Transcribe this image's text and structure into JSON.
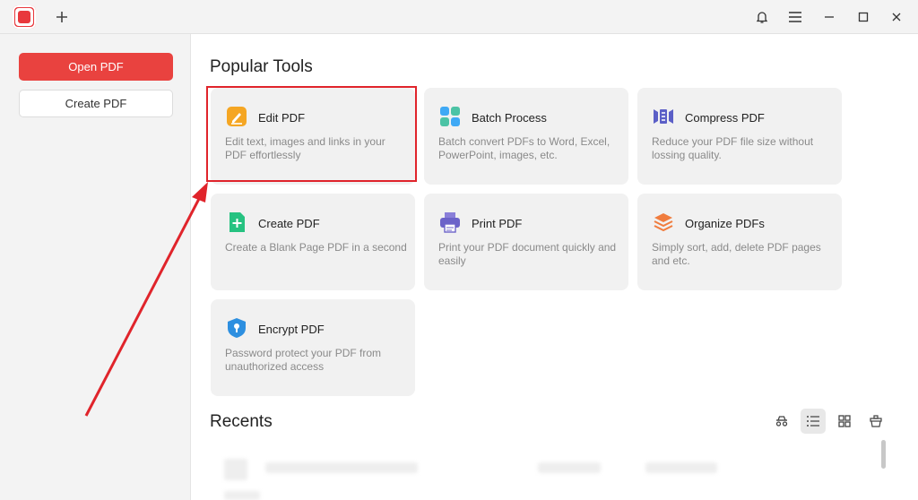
{
  "window": {
    "app_icon": "pdf-app-logo",
    "new_tab_icon": "plus-icon",
    "controls": [
      "bell-icon",
      "menu-icon",
      "minimize-icon",
      "maximize-icon",
      "close-icon"
    ]
  },
  "sidebar": {
    "open_label": "Open PDF",
    "create_label": "Create PDF"
  },
  "main": {
    "title": "Popular Tools",
    "tools": [
      {
        "name": "Edit PDF",
        "desc": "Edit text, images and links in your PDF effortlessly",
        "icon": "edit-pdf-icon"
      },
      {
        "name": "Batch Process",
        "desc": "Batch convert PDFs to Word, Excel, PowerPoint, images, etc.",
        "icon": "batch-grid-icon"
      },
      {
        "name": "Compress PDF",
        "desc": "Reduce your PDF file size without lossing quality.",
        "icon": "compress-icon"
      },
      {
        "name": "Create PDF",
        "desc": "Create a Blank Page PDF in a second",
        "icon": "create-plus-icon"
      },
      {
        "name": "Print PDF",
        "desc": "Print your PDF document quickly and easily",
        "icon": "printer-icon"
      },
      {
        "name": "Organize PDFs",
        "desc": "Simply sort, add, delete PDF pages and etc.",
        "icon": "layers-icon"
      },
      {
        "name": "Encrypt PDF",
        "desc": "Password protect your PDF from unauthorized access",
        "icon": "shield-lock-icon"
      }
    ],
    "recents_title": "Recents",
    "recents_views": [
      "incognito-icon",
      "list-view-icon",
      "grid-view-icon",
      "clear-history-icon"
    ]
  },
  "colors": {
    "accent": "#e9423f",
    "annotation": "#e0242b",
    "card_bg": "#f1f1f1"
  }
}
